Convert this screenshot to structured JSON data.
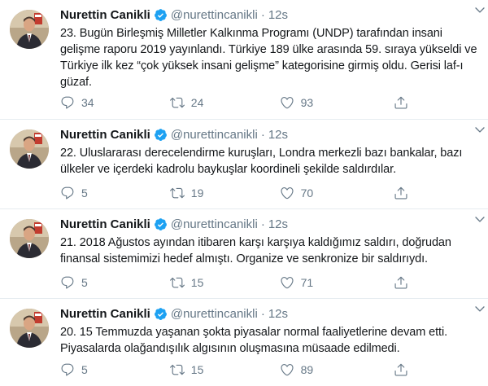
{
  "tweets": [
    {
      "name": "Nurettin Canikli",
      "handle": "@nurettincanikli",
      "separator": "·",
      "time": "12s",
      "text": "23. Bugün Birleşmiş Milletler Kalkınma Programı (UNDP) tarafından insani gelişme raporu 2019 yayınlandı. Türkiye 189 ülke arasında 59. sıraya yükseldi ve Türkiye ilk kez “çok yüksek insani gelişme” kategorisine girmiş oldu. Gerisi laf-ı güzaf.",
      "replies": "34",
      "retweets": "24",
      "likes": "93"
    },
    {
      "name": "Nurettin Canikli",
      "handle": "@nurettincanikli",
      "separator": "·",
      "time": "12s",
      "text": "22. Uluslararası derecelendirme kuruşları, Londra merkezli bazı bankalar, bazı ülkeler ve içerdeki kadrolu baykuşlar koordineli şekilde saldırdılar.",
      "replies": "5",
      "retweets": "19",
      "likes": "70"
    },
    {
      "name": "Nurettin Canikli",
      "handle": "@nurettincanikli",
      "separator": "·",
      "time": "12s",
      "text": "21. 2018 Ağustos ayından itibaren karşı karşıya kaldığımız saldırı, doğrudan finansal sistemimizi hedef almıştı. Organize ve senkronize bir saldırıydı.",
      "replies": "5",
      "retweets": "15",
      "likes": "71"
    },
    {
      "name": "Nurettin Canikli",
      "handle": "@nurettincanikli",
      "separator": "·",
      "time": "12s",
      "text": "20. 15 Temmuzda yaşanan şokta piyasalar normal faaliyetlerine devam etti. Piyasalarda olağandışılık algısının oluşmasına müsaade edilmedi.",
      "replies": "5",
      "retweets": "15",
      "likes": "89"
    }
  ],
  "icons": {
    "verified": "verified-badge-icon",
    "caret": "chevron-down-icon",
    "reply": "reply-icon",
    "retweet": "retweet-icon",
    "like": "heart-icon",
    "share": "share-icon"
  },
  "colors": {
    "verified": "#1da1f2",
    "secondary_text": "#657786",
    "primary_text": "#14171a",
    "divider": "#e6ecf0"
  }
}
